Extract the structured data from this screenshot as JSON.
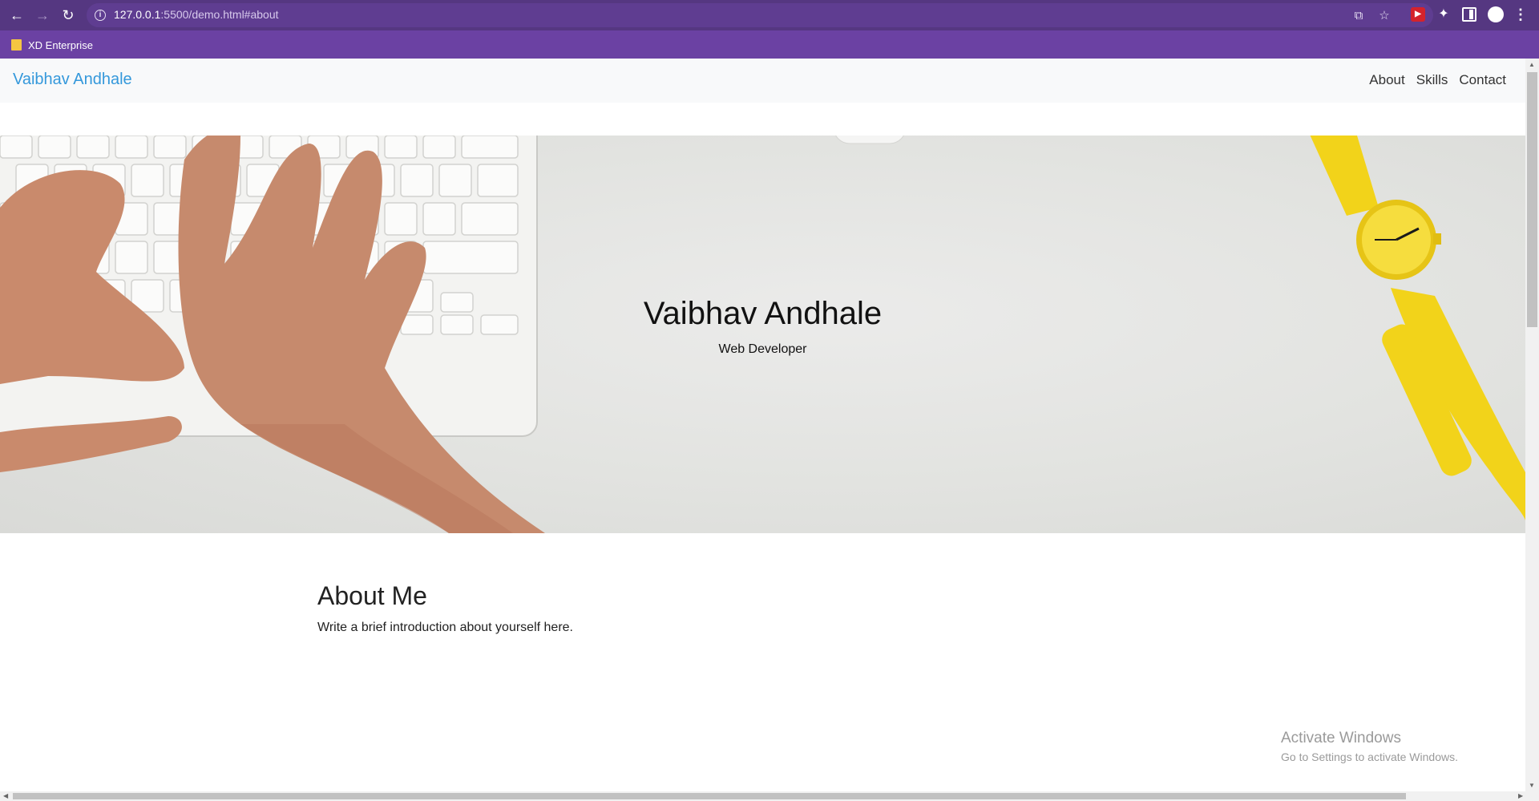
{
  "browser": {
    "url_host": "127.0.0.1",
    "url_rest": ":5500/demo.html#about",
    "bookmarks": [
      {
        "label": "XD Enterprise",
        "icon": "folder-icon"
      }
    ],
    "icons": [
      "back-arrow-icon",
      "forward-arrow-icon",
      "reload-icon",
      "info-icon",
      "share-icon",
      "star-icon",
      "extension-icon",
      "puzzle-icon",
      "side-panel-icon",
      "profile-icon",
      "menu-icon"
    ],
    "accent": "#553781"
  },
  "site": {
    "brand": "Vaibhav Andhale",
    "brand_color": "#3498db",
    "nav": [
      {
        "label": "About"
      },
      {
        "label": "Skills"
      },
      {
        "label": "Contact"
      }
    ]
  },
  "hero": {
    "title": "Vaibhav Andhale",
    "subtitle": "Web Developer"
  },
  "about": {
    "heading": "About Me",
    "text": "Write a brief introduction about yourself here."
  },
  "watermark": {
    "line1": "Activate Windows",
    "line2": "Go to Settings to activate Windows."
  }
}
